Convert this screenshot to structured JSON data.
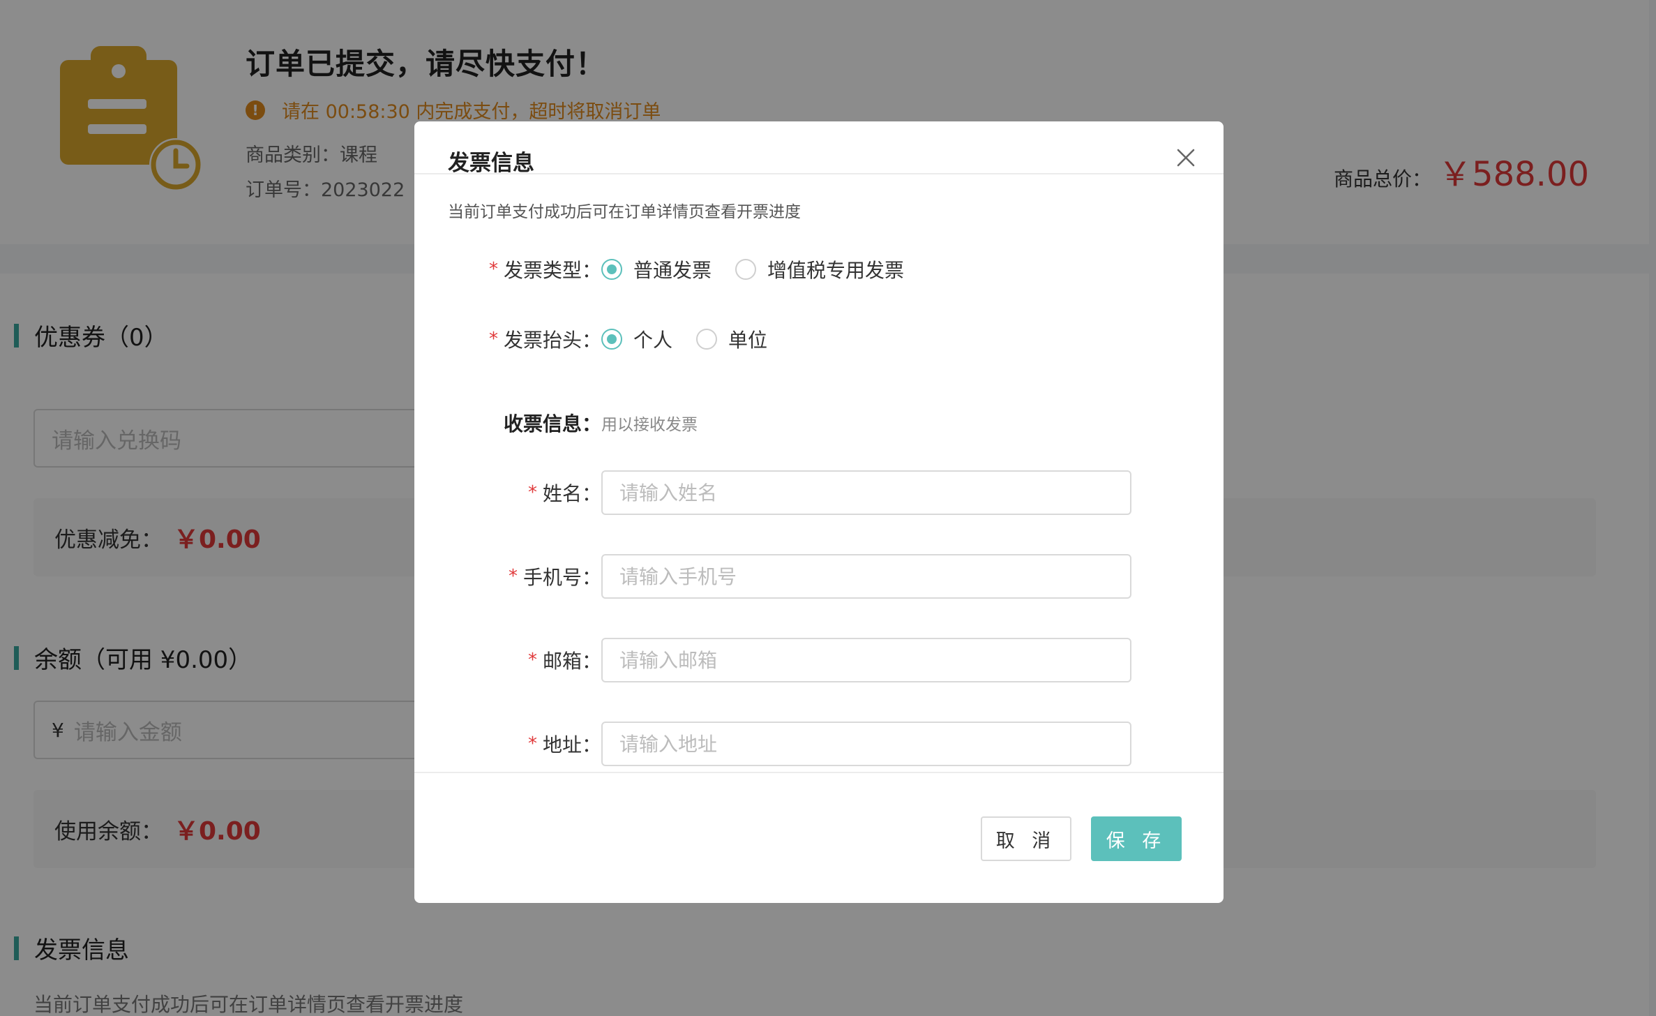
{
  "order": {
    "title": "订单已提交，请尽快支付！",
    "countdown": "请在 00:58:30 内完成支付，超时将取消订单",
    "warn_glyph": "!",
    "category": "商品类别：课程",
    "order_no": "订单号：2023022",
    "total_label": "商品总价：",
    "total_price": "￥588.00"
  },
  "coupon": {
    "title": "优惠券（0）",
    "placeholder": "请输入兑换码",
    "discount_label": "优惠减免：",
    "discount_value": "￥0.00"
  },
  "balance": {
    "title": "余额（可用 ¥0.00）",
    "yen": "¥",
    "placeholder": "请输入金额",
    "use_label": "使用余额：",
    "use_value": "￥0.00"
  },
  "invoice_section": {
    "title": "发票信息",
    "note": "当前订单支付成功后可在订单详情页查看开票进度"
  },
  "modal": {
    "title": "发票信息",
    "tip": "当前订单支付成功后可在订单详情页查看开票进度",
    "invoice_type": {
      "label": "发票类型：",
      "options": [
        "普通发票",
        "增值税专用发票"
      ],
      "selected": "普通发票"
    },
    "invoice_header": {
      "label": "发票抬头：",
      "options": [
        "个人",
        "单位"
      ],
      "selected": "个人"
    },
    "receiver": {
      "label": "收票信息：",
      "hint": "用以接收发票"
    },
    "fields": {
      "name": {
        "label": "姓名：",
        "placeholder": "请输入姓名"
      },
      "phone": {
        "label": "手机号：",
        "placeholder": "请输入手机号"
      },
      "email": {
        "label": "邮箱：",
        "placeholder": "请输入邮箱"
      },
      "address": {
        "label": "地址：",
        "placeholder": "请输入地址"
      }
    },
    "required_mark": "*",
    "cancel_label": "取 消",
    "save_label": "保 存"
  },
  "colors": {
    "accent": "#5cc0bb",
    "price_red": "#e0393a",
    "warning": "#e08a1e",
    "icon_gold": "#dba82d"
  }
}
